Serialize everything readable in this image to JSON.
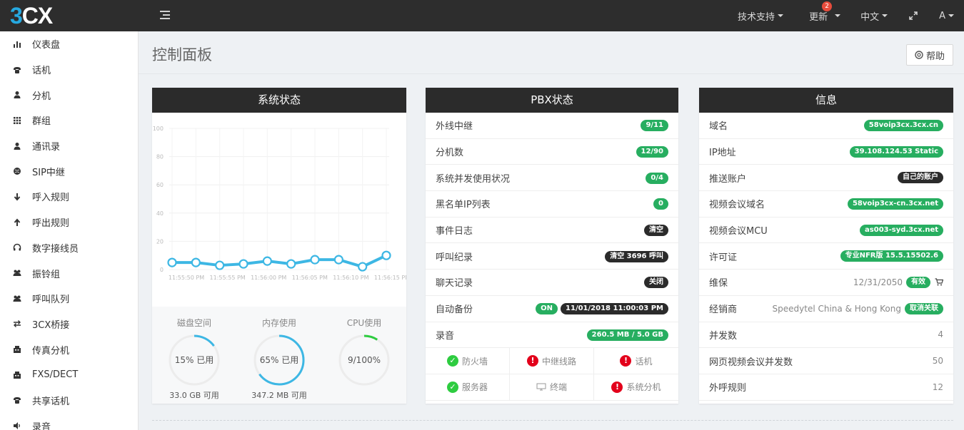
{
  "app": {
    "logo_prefix": "3",
    "logo_suffix": "CX"
  },
  "topnav": {
    "support": "技术支持",
    "updates": "更新",
    "updates_badge": "2",
    "language": "中文",
    "user": "A"
  },
  "sidebar": {
    "items": [
      {
        "label": "仪表盘",
        "icon": "bar-chart-icon"
      },
      {
        "label": "话机",
        "icon": "phone-icon"
      },
      {
        "label": "分机",
        "icon": "user-icon"
      },
      {
        "label": "群组",
        "icon": "grid-icon"
      },
      {
        "label": "通讯录",
        "icon": "user-icon"
      },
      {
        "label": "SIP中继",
        "icon": "globe-icon"
      },
      {
        "label": "呼入规则",
        "icon": "arrow-down-icon"
      },
      {
        "label": "呼出规则",
        "icon": "arrow-up-icon"
      },
      {
        "label": "数字接线员",
        "icon": "headset-icon"
      },
      {
        "label": "振铃组",
        "icon": "users-icon"
      },
      {
        "label": "呼叫队列",
        "icon": "users-icon"
      },
      {
        "label": "3CX桥接",
        "icon": "exchange-icon"
      },
      {
        "label": "传真分机",
        "icon": "fax-icon"
      },
      {
        "label": "FXS/DECT",
        "icon": "fax-icon"
      },
      {
        "label": "共享话机",
        "icon": "phone-icon"
      },
      {
        "label": "录音",
        "icon": "speaker-icon"
      }
    ]
  },
  "page": {
    "title": "控制面板",
    "help": "帮助"
  },
  "system_status": {
    "title": "系统状态",
    "disk": {
      "label": "磁盘空间",
      "value": "15% 已用",
      "percent": 15,
      "sub": "33.0 GB 可用"
    },
    "memory": {
      "label": "内存使用",
      "value": "65% 已用",
      "percent": 65,
      "sub": "347.2 MB 可用"
    },
    "cpu": {
      "label": "CPU使用",
      "value": "9/100%",
      "percent": 9,
      "sub": ""
    }
  },
  "chart_data": {
    "type": "line",
    "y_ticks": [
      "100",
      "80",
      "60",
      "40",
      "20",
      "0"
    ],
    "ylim": [
      0,
      100
    ],
    "x_ticks": [
      "11:55:50 PM",
      "11:55:55 PM",
      "11:56:00 PM",
      "11:56:05 PM",
      "11:56:10 PM",
      "11:56:15 PM"
    ],
    "values": [
      5,
      5,
      3,
      4,
      6,
      4,
      7,
      7,
      2,
      10
    ]
  },
  "pbx_status": {
    "title": "PBX状态",
    "rows": [
      {
        "label": "外线中继",
        "badges": [
          {
            "text": "9/11",
            "style": "green"
          }
        ]
      },
      {
        "label": "分机数",
        "badges": [
          {
            "text": "12/90",
            "style": "green"
          }
        ]
      },
      {
        "label": "系统并发使用状况",
        "badges": [
          {
            "text": "0/4",
            "style": "green"
          }
        ]
      },
      {
        "label": "黑名单IP列表",
        "badges": [
          {
            "text": "0",
            "style": "green"
          }
        ]
      },
      {
        "label": "事件日志",
        "badges": [
          {
            "text": "清空",
            "style": "dark"
          }
        ]
      },
      {
        "label": "呼叫纪录",
        "badges": [
          {
            "text": "清空 3696 呼叫",
            "style": "dark"
          }
        ]
      },
      {
        "label": "聊天记录",
        "badges": [
          {
            "text": "关闭",
            "style": "dark"
          }
        ]
      },
      {
        "label": "自动备份",
        "badges": [
          {
            "text": "ON",
            "style": "green"
          },
          {
            "text": "11/01/2018 11:00:03 PM",
            "style": "dark"
          }
        ]
      },
      {
        "label": "录音",
        "badges": [
          {
            "text": "260.5 MB / 5.0 GB",
            "style": "green"
          }
        ]
      }
    ],
    "services": [
      {
        "label": "防火墙",
        "state": "ok"
      },
      {
        "label": "中继线路",
        "state": "err"
      },
      {
        "label": "话机",
        "state": "err"
      },
      {
        "label": "服务器",
        "state": "ok"
      },
      {
        "label": "终端",
        "state": "monitor"
      },
      {
        "label": "系统分机",
        "state": "err"
      }
    ]
  },
  "info": {
    "title": "信息",
    "rows": [
      {
        "label": "域名",
        "text": "",
        "badge": "58voip3cx.3cx.cn",
        "style": "green"
      },
      {
        "label": "IP地址",
        "text": "",
        "badge": "39.108.124.53 Static",
        "style": "green"
      },
      {
        "label": "推送账户",
        "text": "",
        "badge": "自己的账户",
        "style": "dark"
      },
      {
        "label": "视频会议域名",
        "text": "",
        "badge": "58voip3cx-cn.3cx.net",
        "style": "green"
      },
      {
        "label": "视频会议MCU",
        "text": "",
        "badge": "as003-syd.3cx.net",
        "style": "green"
      },
      {
        "label": "许可证",
        "text": "",
        "badge": "专业NFR版 15.5.15502.6",
        "style": "green"
      },
      {
        "label": "维保",
        "text": "12/31/2050",
        "badge": "有效",
        "style": "green",
        "cart": true
      },
      {
        "label": "经销商",
        "text": "Speedytel China & Hong Kong",
        "badge": "取消关联",
        "style": "green"
      },
      {
        "label": "并发数",
        "text": "4",
        "badge": "",
        "style": ""
      },
      {
        "label": "网页视频会议并发数",
        "text": "50",
        "badge": "",
        "style": ""
      },
      {
        "label": "外呼规则",
        "text": "12",
        "badge": "",
        "style": ""
      }
    ]
  },
  "colors": {
    "accent": "#26a9e0",
    "green": "#27ae60",
    "dark": "#2b2b2b",
    "error": "#e3001b",
    "gauge": "#3db7e4",
    "cpu_gauge": "#2ecc40"
  }
}
